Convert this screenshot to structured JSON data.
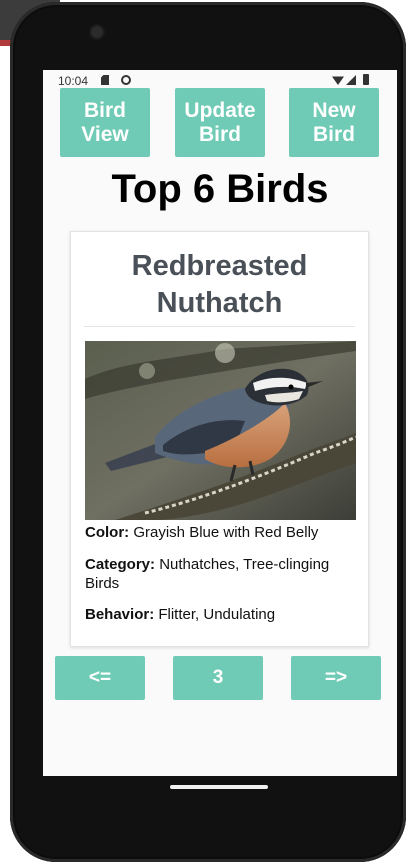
{
  "status_bar": {
    "time": "10:04"
  },
  "toolbar": {
    "bird_view_label": "Bird View",
    "update_bird_label": "Update Bird",
    "new_bird_label": "New Bird"
  },
  "page": {
    "title": "Top 6 Birds"
  },
  "bird": {
    "name": "Redbreasted Nuthatch",
    "color_label": "Color:",
    "color_value": "Grayish Blue with Red Belly",
    "category_label": "Category:",
    "category_value": "Nuthatches, Tree-clinging Birds",
    "behavior_label": "Behavior:",
    "behavior_value": "Flitter, Undulating",
    "image_icon": "bird-photo"
  },
  "pager": {
    "prev_label": "<=",
    "current_page": "3",
    "next_label": "=>"
  },
  "colors": {
    "accent": "#6fcbb5",
    "title_text": "#4a5057",
    "screen_bg": "#fafafa"
  }
}
